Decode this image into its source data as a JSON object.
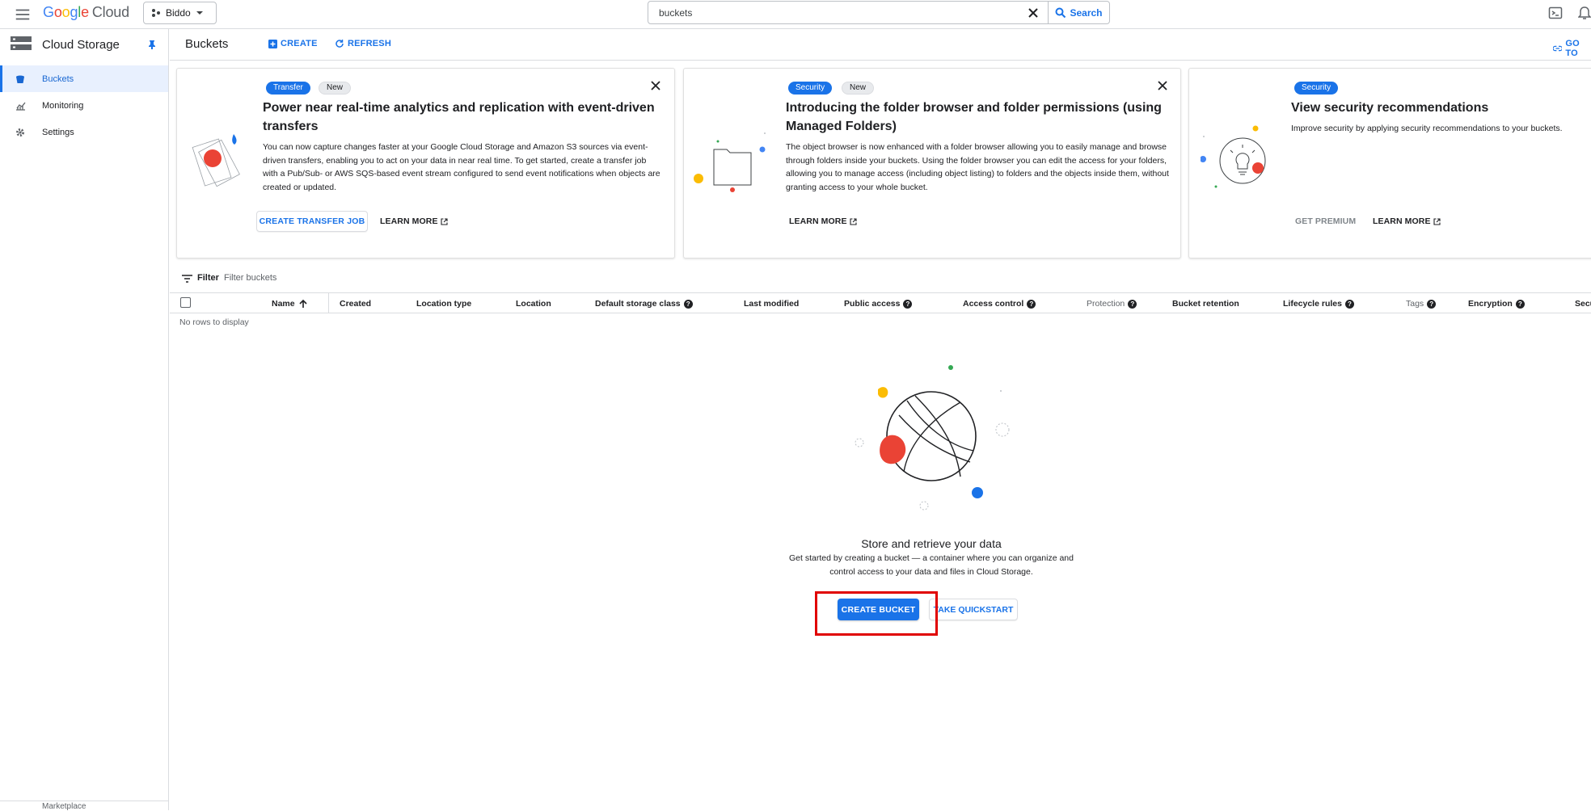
{
  "topbar": {
    "logo_letters": [
      "G",
      "o",
      "o",
      "g",
      "l",
      "e"
    ],
    "logo_suffix": "Cloud",
    "project": "Biddo",
    "search_value": "buckets",
    "search_button": "Search"
  },
  "sidenav": {
    "title": "Cloud Storage",
    "items": [
      {
        "label": "Buckets",
        "icon": "bucket-icon"
      },
      {
        "label": "Monitoring",
        "icon": "chart-icon"
      },
      {
        "label": "Settings",
        "icon": "gear-icon"
      }
    ],
    "bottom_label": "Marketplace"
  },
  "header": {
    "title": "Buckets",
    "create": "CREATE",
    "refresh": "REFRESH",
    "goto": "GO TO"
  },
  "cards": [
    {
      "chips": [
        "Transfer",
        "New"
      ],
      "title": "Power near real-time analytics and replication with event-driven transfers",
      "body": "You can now capture changes faster at your Google Cloud Storage and Amazon S3 sources via event-driven transfers, enabling you to act on your data in near real time. To get started, create a transfer job with a Pub/Sub- or AWS SQS-based event stream configured to send event notifications when objects are created or updated.",
      "primary": "CREATE TRANSFER JOB",
      "secondary": "LEARN MORE"
    },
    {
      "chips": [
        "Security",
        "New"
      ],
      "title": "Introducing the folder browser and folder permissions (using Managed Folders)",
      "body": "The object browser is now enhanced with a folder browser allowing you to easily manage and browse through folders inside your buckets. Using the folder browser you can edit the access for your folders, allowing you to manage access (including object listing) to folders and the objects inside them, without granting access to your whole bucket.",
      "secondary": "LEARN MORE"
    },
    {
      "chips": [
        "Security"
      ],
      "title": "View security recommendations",
      "body": "Improve security by applying security recommendations to your buckets.",
      "primary": "GET PREMIUM",
      "secondary": "LEARN MORE"
    }
  ],
  "filter": {
    "label": "Filter",
    "placeholder": "Filter buckets"
  },
  "table": {
    "columns": [
      "Name",
      "Created",
      "Location type",
      "Location",
      "Default storage class",
      "Last modified",
      "Public access",
      "Access control",
      "Protection",
      "Bucket retention",
      "Lifecycle rules",
      "Tags",
      "Encryption",
      "Secu"
    ],
    "empty": "No rows to display"
  },
  "empty_state": {
    "title": "Store and retrieve your data",
    "desc": "Get started by creating a bucket — a container where you can organize and control access to your data and files in Cloud Storage.",
    "primary": "CREATE BUCKET",
    "secondary": "TAKE QUICKSTART"
  },
  "colors": {
    "accent": "#1a73e8",
    "highlight": "#e00000"
  }
}
